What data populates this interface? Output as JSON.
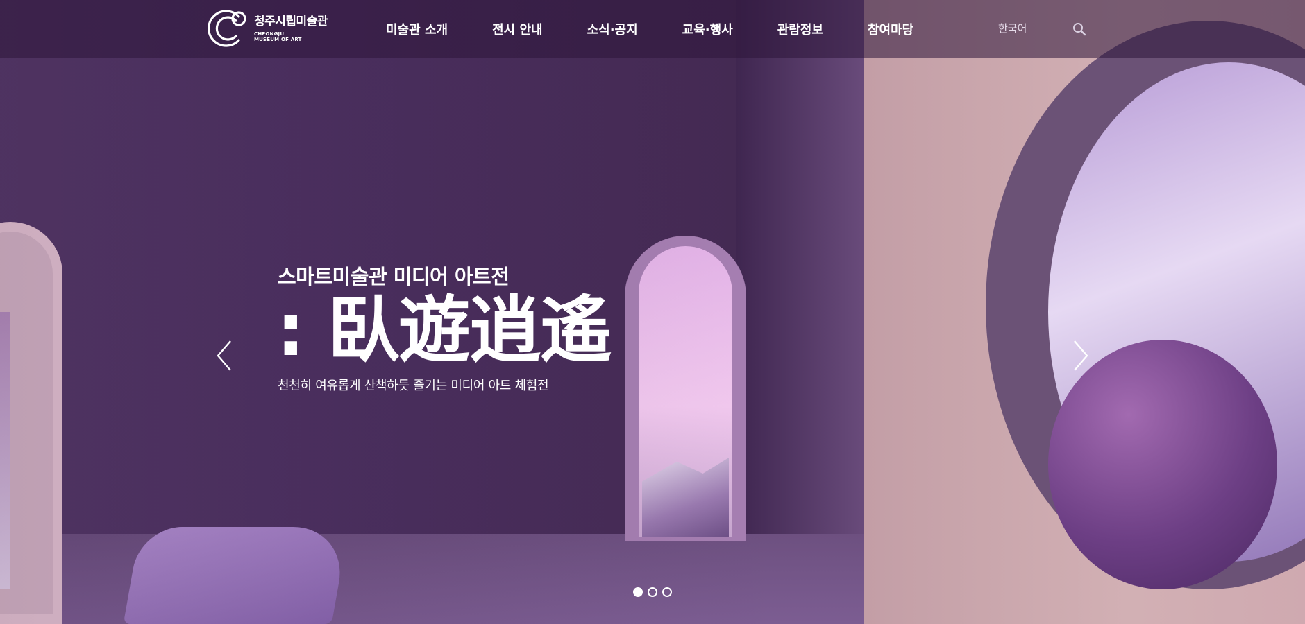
{
  "header": {
    "logo": {
      "name_ko": "청주시립미술관",
      "name_en_line1": "CHEONGJU",
      "name_en_line2": "MUSEUM OF ART"
    },
    "nav": [
      {
        "label": "미술관 소개"
      },
      {
        "label": "전시 안내"
      },
      {
        "label": "소식·공지"
      },
      {
        "label": "교육·행사"
      },
      {
        "label": "관람정보"
      },
      {
        "label": "참여마당"
      }
    ],
    "language": "한국어",
    "search_icon": "search-icon"
  },
  "slide": {
    "subtitle": "스마트미술관 미디어 아트전",
    "title": ": 臥遊逍遙",
    "description": "천천히 여유롭게 산책하듯 즐기는 미디어 아트 체험전"
  },
  "carousel": {
    "prev_icon": "chevron-left-icon",
    "next_icon": "chevron-right-icon",
    "active_index": 0,
    "dot_count": 3
  },
  "colors": {
    "header_bg": "#2d163a",
    "accent": "#ffffff",
    "scene_purple": "#4c3060"
  }
}
